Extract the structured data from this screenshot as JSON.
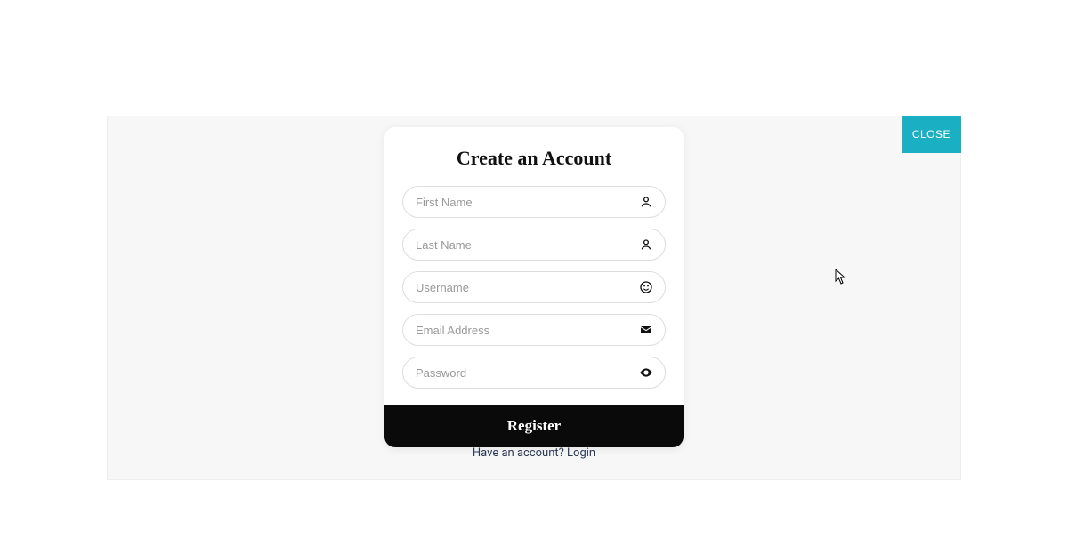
{
  "close_label": "CLOSE",
  "form": {
    "title": "Create an Account",
    "fields": {
      "first_name": {
        "placeholder": "First Name",
        "value": ""
      },
      "last_name": {
        "placeholder": "Last Name",
        "value": ""
      },
      "username": {
        "placeholder": "Username",
        "value": ""
      },
      "email": {
        "placeholder": "Email Address",
        "value": ""
      },
      "password": {
        "placeholder": "Password",
        "value": ""
      }
    },
    "submit_label": "Register"
  },
  "login_prompt": {
    "text": "Have an account? ",
    "link_label": "Login"
  }
}
